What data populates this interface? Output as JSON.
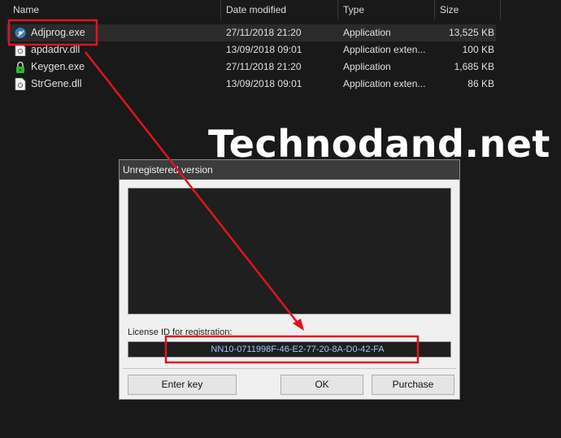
{
  "explorer": {
    "columns": [
      "Name",
      "Date modified",
      "Type",
      "Size"
    ],
    "rows": [
      {
        "name": "Adjprog.exe",
        "date": "27/11/2018 21:20",
        "type": "Application",
        "size": "13,525 KB",
        "icon": "app-exe-icon",
        "selected": true
      },
      {
        "name": "apdadrv.dll",
        "date": "13/09/2018 09:01",
        "type": "Application exten...",
        "size": "100 KB",
        "icon": "dll-file-icon",
        "selected": false
      },
      {
        "name": "Keygen.exe",
        "date": "27/11/2018 21:20",
        "type": "Application",
        "size": "1,685 KB",
        "icon": "keygen-lock-icon",
        "selected": false
      },
      {
        "name": "StrGene.dll",
        "date": "13/09/2018 09:01",
        "type": "Application exten...",
        "size": "86 KB",
        "icon": "dll-file-icon",
        "selected": false
      }
    ]
  },
  "watermark": "Technodand.net",
  "dialog": {
    "title": "Unregistered version",
    "license_label": "License ID for registration:",
    "license_id": "NN10-0711998F-46-E2-77-20-8A-D0-42-FA",
    "buttons": {
      "enter_key": "Enter key",
      "ok": "OK",
      "purchase": "Purchase"
    }
  },
  "colors": {
    "annotation": "#e0141e",
    "background": "#191919",
    "dialog": "#f0f0f0"
  }
}
